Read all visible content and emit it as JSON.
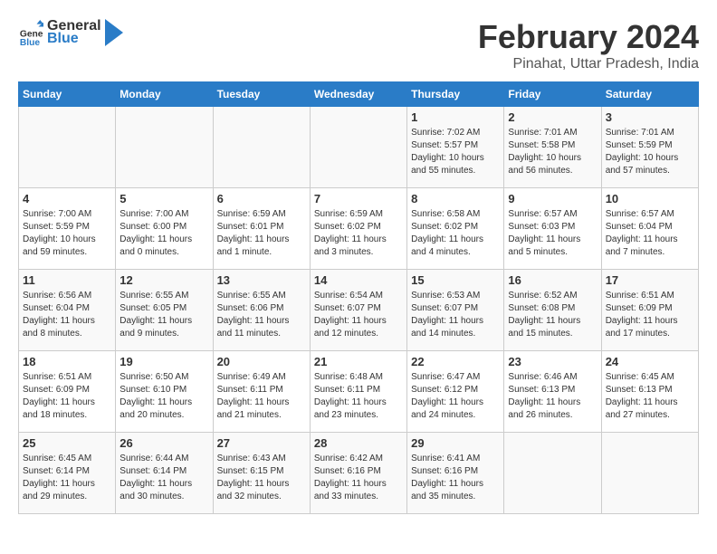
{
  "logo": {
    "general": "General",
    "blue": "Blue"
  },
  "title": "February 2024",
  "subtitle": "Pinahat, Uttar Pradesh, India",
  "days_of_week": [
    "Sunday",
    "Monday",
    "Tuesday",
    "Wednesday",
    "Thursday",
    "Friday",
    "Saturday"
  ],
  "weeks": [
    [
      {
        "day": "",
        "info": ""
      },
      {
        "day": "",
        "info": ""
      },
      {
        "day": "",
        "info": ""
      },
      {
        "day": "",
        "info": ""
      },
      {
        "day": "1",
        "info": "Sunrise: 7:02 AM\nSunset: 5:57 PM\nDaylight: 10 hours and 55 minutes."
      },
      {
        "day": "2",
        "info": "Sunrise: 7:01 AM\nSunset: 5:58 PM\nDaylight: 10 hours and 56 minutes."
      },
      {
        "day": "3",
        "info": "Sunrise: 7:01 AM\nSunset: 5:59 PM\nDaylight: 10 hours and 57 minutes."
      }
    ],
    [
      {
        "day": "4",
        "info": "Sunrise: 7:00 AM\nSunset: 5:59 PM\nDaylight: 10 hours and 59 minutes."
      },
      {
        "day": "5",
        "info": "Sunrise: 7:00 AM\nSunset: 6:00 PM\nDaylight: 11 hours and 0 minutes."
      },
      {
        "day": "6",
        "info": "Sunrise: 6:59 AM\nSunset: 6:01 PM\nDaylight: 11 hours and 1 minute."
      },
      {
        "day": "7",
        "info": "Sunrise: 6:59 AM\nSunset: 6:02 PM\nDaylight: 11 hours and 3 minutes."
      },
      {
        "day": "8",
        "info": "Sunrise: 6:58 AM\nSunset: 6:02 PM\nDaylight: 11 hours and 4 minutes."
      },
      {
        "day": "9",
        "info": "Sunrise: 6:57 AM\nSunset: 6:03 PM\nDaylight: 11 hours and 5 minutes."
      },
      {
        "day": "10",
        "info": "Sunrise: 6:57 AM\nSunset: 6:04 PM\nDaylight: 11 hours and 7 minutes."
      }
    ],
    [
      {
        "day": "11",
        "info": "Sunrise: 6:56 AM\nSunset: 6:04 PM\nDaylight: 11 hours and 8 minutes."
      },
      {
        "day": "12",
        "info": "Sunrise: 6:55 AM\nSunset: 6:05 PM\nDaylight: 11 hours and 9 minutes."
      },
      {
        "day": "13",
        "info": "Sunrise: 6:55 AM\nSunset: 6:06 PM\nDaylight: 11 hours and 11 minutes."
      },
      {
        "day": "14",
        "info": "Sunrise: 6:54 AM\nSunset: 6:07 PM\nDaylight: 11 hours and 12 minutes."
      },
      {
        "day": "15",
        "info": "Sunrise: 6:53 AM\nSunset: 6:07 PM\nDaylight: 11 hours and 14 minutes."
      },
      {
        "day": "16",
        "info": "Sunrise: 6:52 AM\nSunset: 6:08 PM\nDaylight: 11 hours and 15 minutes."
      },
      {
        "day": "17",
        "info": "Sunrise: 6:51 AM\nSunset: 6:09 PM\nDaylight: 11 hours and 17 minutes."
      }
    ],
    [
      {
        "day": "18",
        "info": "Sunrise: 6:51 AM\nSunset: 6:09 PM\nDaylight: 11 hours and 18 minutes."
      },
      {
        "day": "19",
        "info": "Sunrise: 6:50 AM\nSunset: 6:10 PM\nDaylight: 11 hours and 20 minutes."
      },
      {
        "day": "20",
        "info": "Sunrise: 6:49 AM\nSunset: 6:11 PM\nDaylight: 11 hours and 21 minutes."
      },
      {
        "day": "21",
        "info": "Sunrise: 6:48 AM\nSunset: 6:11 PM\nDaylight: 11 hours and 23 minutes."
      },
      {
        "day": "22",
        "info": "Sunrise: 6:47 AM\nSunset: 6:12 PM\nDaylight: 11 hours and 24 minutes."
      },
      {
        "day": "23",
        "info": "Sunrise: 6:46 AM\nSunset: 6:13 PM\nDaylight: 11 hours and 26 minutes."
      },
      {
        "day": "24",
        "info": "Sunrise: 6:45 AM\nSunset: 6:13 PM\nDaylight: 11 hours and 27 minutes."
      }
    ],
    [
      {
        "day": "25",
        "info": "Sunrise: 6:45 AM\nSunset: 6:14 PM\nDaylight: 11 hours and 29 minutes."
      },
      {
        "day": "26",
        "info": "Sunrise: 6:44 AM\nSunset: 6:14 PM\nDaylight: 11 hours and 30 minutes."
      },
      {
        "day": "27",
        "info": "Sunrise: 6:43 AM\nSunset: 6:15 PM\nDaylight: 11 hours and 32 minutes."
      },
      {
        "day": "28",
        "info": "Sunrise: 6:42 AM\nSunset: 6:16 PM\nDaylight: 11 hours and 33 minutes."
      },
      {
        "day": "29",
        "info": "Sunrise: 6:41 AM\nSunset: 6:16 PM\nDaylight: 11 hours and 35 minutes."
      },
      {
        "day": "",
        "info": ""
      },
      {
        "day": "",
        "info": ""
      }
    ]
  ]
}
